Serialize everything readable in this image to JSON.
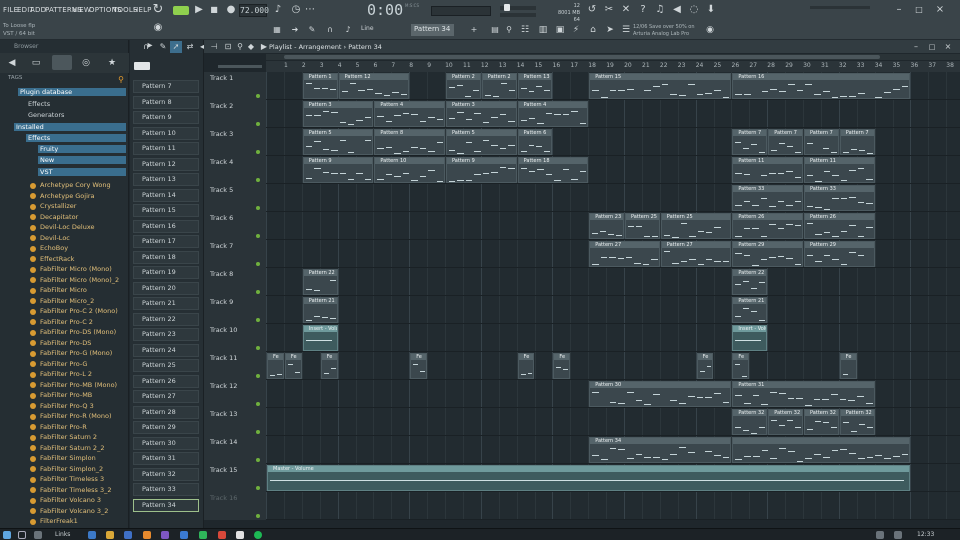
{
  "menu": [
    "FILE",
    "EDIT",
    "ADD",
    "PATTERNS",
    "VIEW",
    "OPTIONS",
    "TOOLS",
    "HELP"
  ],
  "hint_lines": [
    "To Loose flp",
    "VST / 64 bit"
  ],
  "transport": {
    "tempo": "72.000",
    "time": "0:00",
    "time_suffix": "M:S:CS",
    "snap": "Line",
    "pattern_selector": "Pattern 34"
  },
  "meters": {
    "value": "12",
    "memory": "8001 MB",
    "polyphony": "64"
  },
  "news": {
    "line1": "12/06  Save over 50% on",
    "line2": "Arturia Analog Lab Pro"
  },
  "browser": {
    "title": "Browser",
    "tags_label": "TAGS",
    "tree": [
      {
        "label": "Plugin database",
        "selected": true
      },
      {
        "label": "Effects",
        "selected": false
      },
      {
        "label": "Generators",
        "selected": false
      },
      {
        "label": "Installed",
        "selected": true
      },
      {
        "label": "Effects",
        "selected": true
      },
      {
        "label": "Fruity",
        "selected": true
      },
      {
        "label": "New",
        "selected": true
      },
      {
        "label": "VST",
        "selected": true
      }
    ],
    "plugins": [
      "Archetype Cory Wong",
      "Archetype Gojira",
      "Crystallizer",
      "Decapitator",
      "Devil-Loc Deluxe",
      "Devil-Loc",
      "EchoBoy",
      "EffectRack",
      "FabFilter Micro (Mono)",
      "FabFilter Micro (Mono)_2",
      "FabFilter Micro",
      "FabFilter Micro_2",
      "FabFilter Pro-C 2 (Mono)",
      "FabFilter Pro-C 2",
      "FabFilter Pro-DS (Mono)",
      "FabFilter Pro-DS",
      "FabFilter Pro-G (Mono)",
      "FabFilter Pro-G",
      "FabFilter Pro-L 2",
      "FabFilter Pro-MB (Mono)",
      "FabFilter Pro-MB",
      "FabFilter Pro-Q 3",
      "FabFilter Pro-R (Mono)",
      "FabFilter Pro-R",
      "FabFilter Saturn 2",
      "FabFilter Saturn 2_2",
      "FabFilter Simplon",
      "FabFilter Simplon_2",
      "FabFilter Timeless 3",
      "FabFilter Timeless 3_2",
      "FabFilter Volcano 3",
      "FabFilter Volcano 3_2",
      "FilterFreak1"
    ]
  },
  "picker": [
    "Pattern 7",
    "Pattern 8",
    "Pattern 9",
    "Pattern 10",
    "Pattern 11",
    "Pattern 12",
    "Pattern 13",
    "Pattern 14",
    "Pattern 15",
    "Pattern 16",
    "Pattern 17",
    "Pattern 18",
    "Pattern 19",
    "Pattern 20",
    "Pattern 21",
    "Pattern 22",
    "Pattern 23",
    "Pattern 24",
    "Pattern 25",
    "Pattern 26",
    "Pattern 27",
    "Pattern 28",
    "Pattern 29",
    "Pattern 30",
    "Pattern 31",
    "Pattern 32",
    "Pattern 33",
    "Pattern 34"
  ],
  "picker_selected": "Pattern 34",
  "playlist": {
    "breadcrumb": "Playlist - Arrangement › Pattern 34",
    "bars": [
      1,
      2,
      3,
      4,
      5,
      6,
      7,
      8,
      9,
      10,
      11,
      12,
      13,
      14,
      15,
      16,
      17,
      18,
      19,
      20,
      21,
      22,
      23,
      24,
      25,
      26,
      27,
      28,
      29,
      30,
      31,
      32,
      33,
      34,
      35,
      36,
      37,
      38
    ],
    "tracks": [
      "Track 1",
      "Track 2",
      "Track 3",
      "Track 4",
      "Track 5",
      "Track 6",
      "Track 7",
      "Track 8",
      "Track 9",
      "Track 10",
      "Track 11",
      "Track 12",
      "Track 13",
      "Track 14",
      "Track 15",
      "Track 16"
    ],
    "clips": [
      {
        "track": 1,
        "start": 2,
        "len": 2,
        "label": "Pattern 1"
      },
      {
        "track": 1,
        "start": 4,
        "len": 4,
        "label": "Pattern 12"
      },
      {
        "track": 1,
        "start": 10,
        "len": 2,
        "label": "Pattern 2"
      },
      {
        "track": 1,
        "start": 12,
        "len": 2,
        "label": "Pattern 2"
      },
      {
        "track": 1,
        "start": 14,
        "len": 2,
        "label": "Pattern 13"
      },
      {
        "track": 1,
        "start": 18,
        "len": 8,
        "label": "Pattern 15"
      },
      {
        "track": 1,
        "start": 26,
        "len": 10,
        "label": "Pattern 16"
      },
      {
        "track": 2,
        "start": 2,
        "len": 4,
        "label": "Pattern 3"
      },
      {
        "track": 2,
        "start": 6,
        "len": 4,
        "label": "Pattern 4"
      },
      {
        "track": 2,
        "start": 10,
        "len": 4,
        "label": "Pattern 3"
      },
      {
        "track": 2,
        "start": 14,
        "len": 4,
        "label": "Pattern 4"
      },
      {
        "track": 3,
        "start": 2,
        "len": 4,
        "label": "Pattern 5"
      },
      {
        "track": 3,
        "start": 6,
        "len": 4,
        "label": "Pattern 8"
      },
      {
        "track": 3,
        "start": 10,
        "len": 4,
        "label": "Pattern 5"
      },
      {
        "track": 3,
        "start": 14,
        "len": 2,
        "label": "Pattern 6"
      },
      {
        "track": 3,
        "start": 26,
        "len": 2,
        "label": "Pattern 7"
      },
      {
        "track": 3,
        "start": 28,
        "len": 2,
        "label": "Pattern 7"
      },
      {
        "track": 3,
        "start": 30,
        "len": 2,
        "label": "Pattern 7"
      },
      {
        "track": 3,
        "start": 32,
        "len": 2,
        "label": "Pattern 7"
      },
      {
        "track": 4,
        "start": 2,
        "len": 4,
        "label": "Pattern 9"
      },
      {
        "track": 4,
        "start": 6,
        "len": 4,
        "label": "Pattern 10"
      },
      {
        "track": 4,
        "start": 10,
        "len": 4,
        "label": "Pattern 9"
      },
      {
        "track": 4,
        "start": 14,
        "len": 4,
        "label": "Pattern 18"
      },
      {
        "track": 4,
        "start": 26,
        "len": 4,
        "label": "Pattern 11"
      },
      {
        "track": 4,
        "start": 30,
        "len": 4,
        "label": "Pattern 11"
      },
      {
        "track": 5,
        "start": 26,
        "len": 4,
        "label": "Pattern 33"
      },
      {
        "track": 5,
        "start": 30,
        "len": 4,
        "label": "Pattern 33"
      },
      {
        "track": 6,
        "start": 18,
        "len": 2,
        "label": "Pattern 23"
      },
      {
        "track": 6,
        "start": 20,
        "len": 2,
        "label": "Pattern 25"
      },
      {
        "track": 6,
        "start": 22,
        "len": 4,
        "label": "Pattern 25"
      },
      {
        "track": 6,
        "start": 26,
        "len": 4,
        "label": "Pattern 26"
      },
      {
        "track": 6,
        "start": 30,
        "len": 4,
        "label": "Pattern 26"
      },
      {
        "track": 7,
        "start": 18,
        "len": 4,
        "label": "Pattern 27"
      },
      {
        "track": 7,
        "start": 22,
        "len": 4,
        "label": "Pattern 27"
      },
      {
        "track": 7,
        "start": 26,
        "len": 4,
        "label": "Pattern 29"
      },
      {
        "track": 7,
        "start": 30,
        "len": 4,
        "label": "Pattern 29"
      },
      {
        "track": 8,
        "start": 2,
        "len": 2,
        "label": "Pattern 22"
      },
      {
        "track": 8,
        "start": 26,
        "len": 2,
        "label": "Pattern 22"
      },
      {
        "track": 9,
        "start": 2,
        "len": 2,
        "label": "Pattern 21"
      },
      {
        "track": 9,
        "start": 26,
        "len": 2,
        "label": "Pattern 21"
      },
      {
        "track": 11,
        "start": 0,
        "len": 1,
        "label": "Fe"
      },
      {
        "track": 11,
        "start": 1,
        "len": 1,
        "label": "Fe"
      },
      {
        "track": 11,
        "start": 3,
        "len": 1,
        "label": "Fe"
      },
      {
        "track": 11,
        "start": 8,
        "len": 1,
        "label": "Fe"
      },
      {
        "track": 11,
        "start": 14,
        "len": 1,
        "label": "Fe"
      },
      {
        "track": 11,
        "start": 16,
        "len": 1,
        "label": "Fe"
      },
      {
        "track": 11,
        "start": 24,
        "len": 1,
        "label": "Fe"
      },
      {
        "track": 11,
        "start": 26,
        "len": 1,
        "label": "Fe"
      },
      {
        "track": 11,
        "start": 32,
        "len": 1,
        "label": "Fe"
      },
      {
        "track": 12,
        "start": 18,
        "len": 8,
        "label": "Pattern 30"
      },
      {
        "track": 12,
        "start": 26,
        "len": 8,
        "label": "Pattern 31"
      },
      {
        "track": 13,
        "start": 26,
        "len": 2,
        "label": "Pattern 32"
      },
      {
        "track": 13,
        "start": 28,
        "len": 2,
        "label": "Pattern 32"
      },
      {
        "track": 13,
        "start": 30,
        "len": 2,
        "label": "Pattern 32"
      },
      {
        "track": 13,
        "start": 32,
        "len": 2,
        "label": "Pattern 32"
      },
      {
        "track": 14,
        "start": 18,
        "len": 8,
        "label": "Pattern 34"
      },
      {
        "track": 14,
        "start": 26,
        "len": 10,
        "label": ""
      }
    ],
    "automation": [
      {
        "track": 10,
        "start": 2,
        "len": 2,
        "label": "Insert - Volume"
      },
      {
        "track": 10,
        "start": 26,
        "len": 2,
        "label": "Insert - Volume"
      },
      {
        "track": 15,
        "start": 0,
        "len": 36,
        "label": "Master - Volume"
      }
    ]
  },
  "taskbar": {
    "links": "Links",
    "clock": "12:33"
  },
  "colors": {
    "accent_green": "#6fb03e",
    "selection_blue": "#3a6e8e",
    "plugin_text": "#e3c07a"
  }
}
